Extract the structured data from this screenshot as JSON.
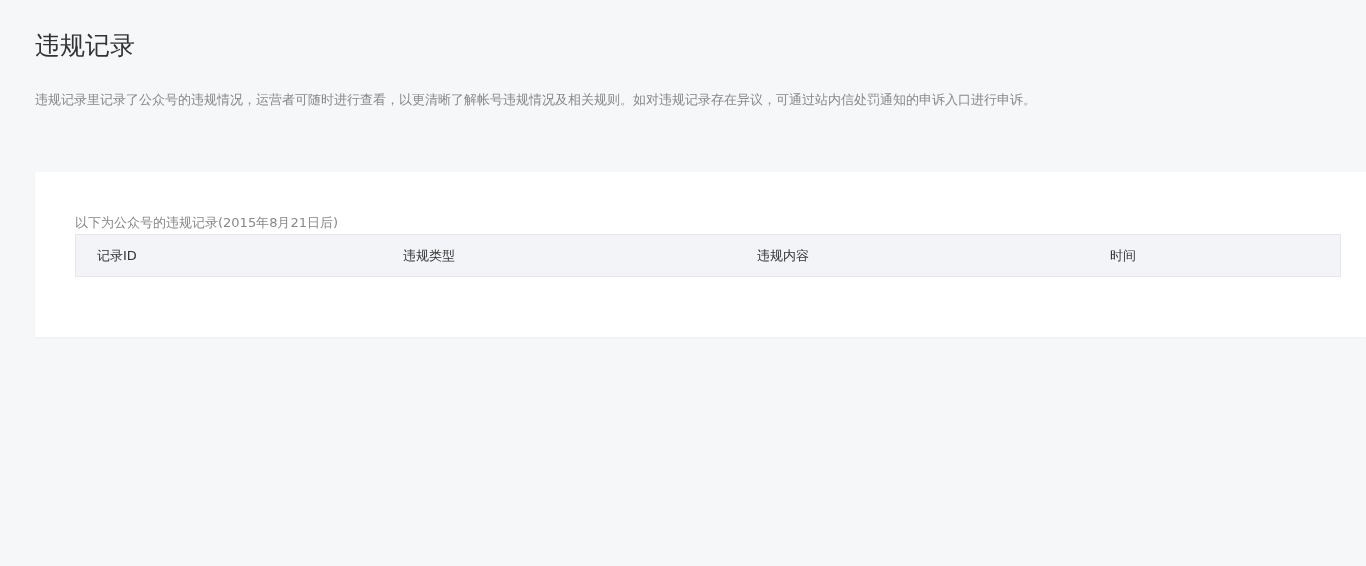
{
  "page": {
    "title": "违规记录",
    "description": "违规记录里记录了公众号的违规情况，运营者可随时进行查看，以更清晰了解帐号违规情况及相关规则。如对违规记录存在异议，可通过站内信处罚通知的申诉入口进行申诉。"
  },
  "records": {
    "caption": "以下为公众号的违规记录(2015年8月21日后)",
    "table": {
      "columns": [
        "记录ID",
        "违规类型",
        "违规内容",
        "时间"
      ]
    }
  }
}
